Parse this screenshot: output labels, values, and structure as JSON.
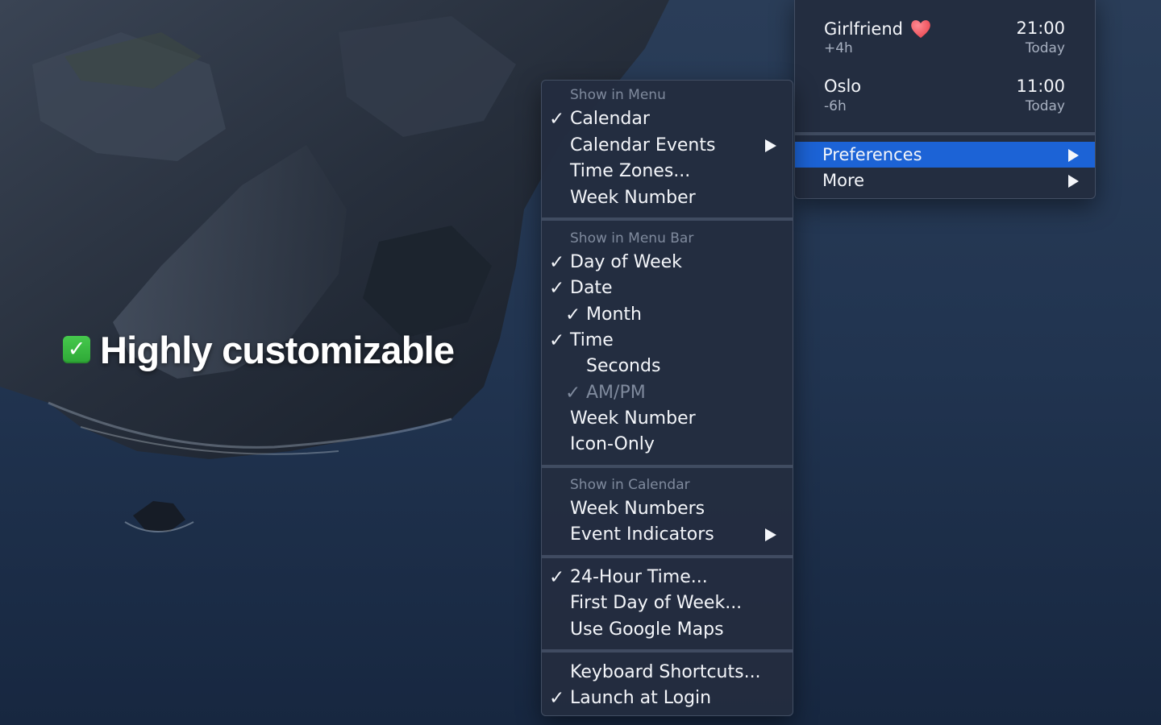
{
  "headline": {
    "text": "Highly customizable",
    "icon": "check-mark-button-icon",
    "icon_glyph": "✓"
  },
  "clock_menu": {
    "timezones": [
      {
        "name": "Girlfriend",
        "offset": "+4h",
        "time": "21:00",
        "day": "Today",
        "icon": "heart-icon"
      },
      {
        "name": "Oslo",
        "offset": "-6h",
        "time": "11:00",
        "day": "Today"
      }
    ],
    "items": [
      {
        "label": "Preferences",
        "selected": true,
        "submenu": true
      },
      {
        "label": "More",
        "submenu": true
      }
    ]
  },
  "preferences_menu": {
    "show_in_menu": {
      "header": "Show in Menu",
      "items": [
        {
          "label": "Calendar",
          "checked": true
        },
        {
          "label": "Calendar Events",
          "submenu": true
        },
        {
          "label": "Time Zones..."
        },
        {
          "label": "Week Number"
        }
      ]
    },
    "show_in_menu_bar": {
      "header": "Show in Menu Bar",
      "items": [
        {
          "label": "Day of Week",
          "checked": true
        },
        {
          "label": "Date",
          "checked": true
        },
        {
          "label": "Month",
          "checked": true,
          "indented": true
        },
        {
          "label": "Time",
          "checked": true
        },
        {
          "label": "Seconds",
          "indented": true
        },
        {
          "label": "AM/PM",
          "checked": true,
          "indented": true,
          "disabled": true
        },
        {
          "label": "Week Number"
        },
        {
          "label": "Icon-Only"
        }
      ]
    },
    "show_in_calendar": {
      "header": "Show in Calendar",
      "items": [
        {
          "label": "Week Numbers"
        },
        {
          "label": "Event Indicators",
          "submenu": true
        }
      ]
    },
    "options": {
      "items": [
        {
          "label": "24-Hour Time...",
          "checked": true
        },
        {
          "label": "First Day of Week..."
        },
        {
          "label": "Use Google Maps"
        }
      ]
    },
    "misc": {
      "items": [
        {
          "label": "Keyboard Shortcuts..."
        },
        {
          "label": "Launch at Login",
          "checked": true
        }
      ]
    },
    "check_glyph": "✓"
  },
  "colors": {
    "menu_bg": "#232d40",
    "highlight": "#1c63d6",
    "text": "#f4f6fa",
    "dim_text": "#7f8a9d",
    "check_emoji_green": "#3bb842"
  }
}
